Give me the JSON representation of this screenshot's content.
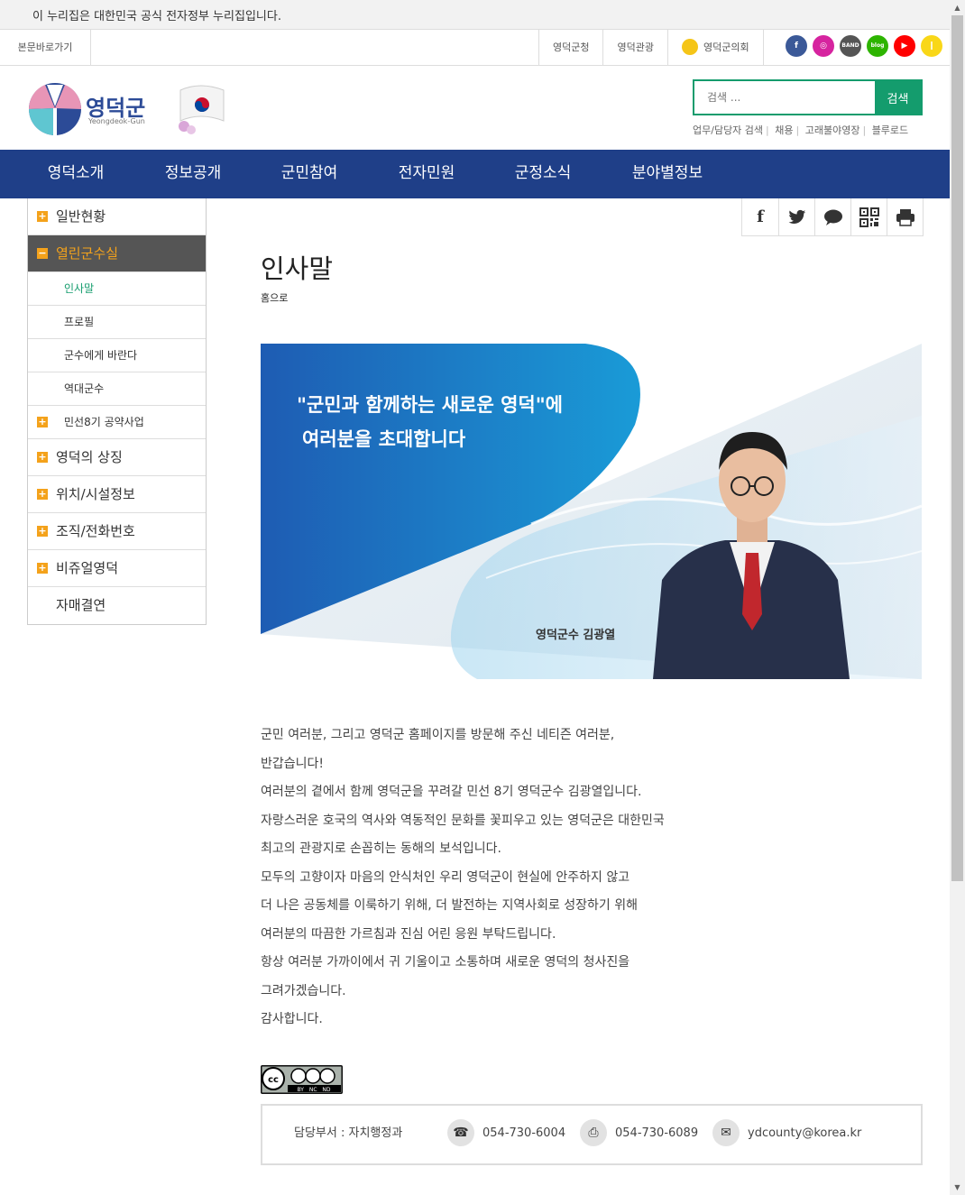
{
  "gov_banner": "이 누리집은 대한민국 공식 전자정부 누리집입니다.",
  "utility": {
    "skip": "본문바로가기",
    "links": [
      "영덕군청",
      "영덕관광",
      "영덕군의회"
    ],
    "sns": [
      {
        "name": "facebook-icon",
        "label": "f",
        "color": "#3b5998"
      },
      {
        "name": "instagram-icon",
        "label": "◎",
        "color": "#d6249f"
      },
      {
        "name": "band-icon",
        "label": "BAND",
        "color": "#555555"
      },
      {
        "name": "blog-icon",
        "label": "blog",
        "color": "#2db400"
      },
      {
        "name": "youtube-icon",
        "label": "▶",
        "color": "#ff0000"
      },
      {
        "name": "kakao-icon",
        "label": "❙",
        "color": "#f9d718"
      }
    ]
  },
  "header": {
    "logo_text": "영덕군",
    "logo_sub": "Yeongdeok-Gun",
    "search_placeholder": "검색 ...",
    "search_button": "검색",
    "quick_links": [
      "업무/담당자 검색",
      "채용",
      "고래불야영장",
      "블루로드"
    ]
  },
  "gnb": [
    "영덕소개",
    "정보공개",
    "군민참여",
    "전자민원",
    "군정소식",
    "분야별정보"
  ],
  "lnb": {
    "top1": "일반현황",
    "active": "열린군수실",
    "subs": [
      "인사말",
      "프로필",
      "군수에게 바란다",
      "역대군수",
      "민선8기 공약사업"
    ],
    "rest": [
      "영덕의 상징",
      "위치/시설정보",
      "조직/전화번호",
      "비쥬얼영덕"
    ],
    "last": "자매결연"
  },
  "share": [
    "f",
    "t",
    "💬",
    "▦",
    "⎙"
  ],
  "page": {
    "title": "인사말",
    "home": "홈으로"
  },
  "hero": {
    "line1": "\"군민과 함께하는 새로운 영덕\"에",
    "line2": "여러분을 초대합니다",
    "name": "영덕군수 김광열"
  },
  "body": [
    "군민 여러분, 그리고 영덕군 홈페이지를 방문해 주신 네티즌 여러분,",
    "반갑습니다!",
    "여러분의 곁에서 함께 영덕군을 꾸려갈 민선 8기 영덕군수 김광열입니다.",
    "자랑스러운 호국의 역사와 역동적인 문화를 꽃피우고 있는 영덕군은 대한민국",
    "최고의 관광지로 손꼽히는 동해의 보석입니다.",
    "모두의 고향이자 마음의 안식처인 우리 영덕군이 현실에 안주하지 않고",
    "더 나은 공동체를 이룩하기 위해, 더 발전하는 지역사회로 성장하기 위해",
    "여러분의 따끔한 가르침과 진심 어린 응원 부탁드립니다.",
    "항상 여러분 가까이에서 귀 기울이고 소통하며 새로운 영덕의 청사진을",
    "그려가겠습니다.",
    "감사합니다."
  ],
  "cc_text": "BY NC ND",
  "footer": {
    "dept": "담당부서 : 자치행정과",
    "phone": "054-730-6004",
    "fax": "054-730-6089",
    "email": "ydcounty@korea.kr"
  }
}
